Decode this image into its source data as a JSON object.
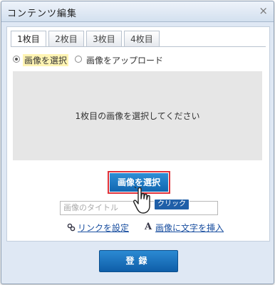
{
  "dialog": {
    "title": "コンテンツ編集",
    "close_glyph": "×"
  },
  "tabs": [
    {
      "label": "1枚目",
      "active": true
    },
    {
      "label": "2枚目",
      "active": false
    },
    {
      "label": "3枚目",
      "active": false
    },
    {
      "label": "4枚目",
      "active": false
    }
  ],
  "radios": [
    {
      "label": "画像を選択",
      "checked": true
    },
    {
      "label": "画像をアップロード",
      "checked": false
    }
  ],
  "preview": {
    "message": "1枚目の画像を選択してください"
  },
  "select_button": {
    "label": "画像を選択"
  },
  "cursor": {
    "badge": "クリック",
    "icon": "hand-pointer-icon"
  },
  "title_input": {
    "placeholder": "画像のタイトル",
    "value": ""
  },
  "links": {
    "link_label": "リンクを設定",
    "link_icon": "chain-link-icon",
    "text_label": "画像に文字を挿入",
    "text_icon_glyph": "A"
  },
  "register_button": {
    "label": "登録"
  },
  "colors": {
    "accent": "#1166b0",
    "highlight_border": "#e0323a",
    "radio_highlight": "#fff4b3"
  }
}
